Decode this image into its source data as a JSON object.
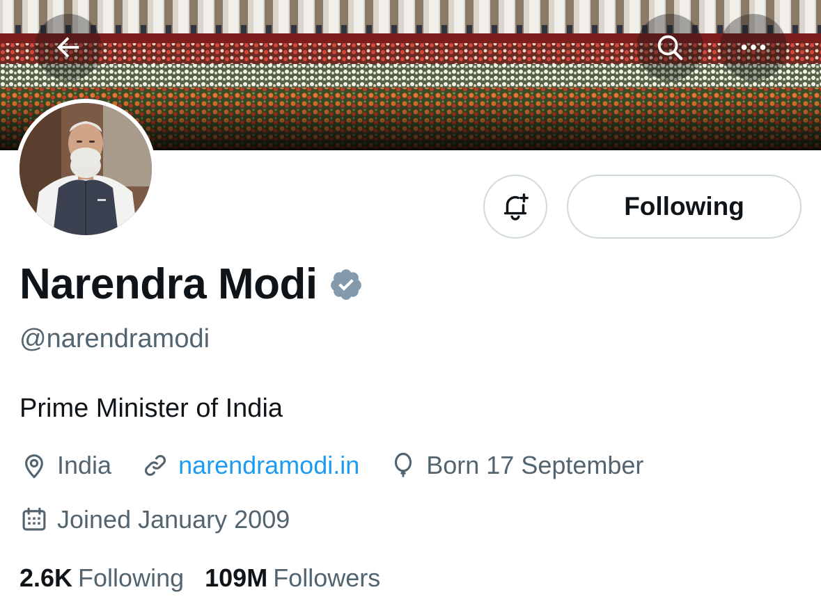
{
  "header": {
    "back_icon": "arrow-left-icon",
    "search_icon": "search-icon",
    "more_icon": "more-horizontal-icon"
  },
  "profile": {
    "name": "Narendra Modi",
    "handle": "@narendramodi",
    "bio": "Prime Minister of India",
    "verified_color": "#829aab"
  },
  "actions": {
    "notify_icon": "bell-plus-icon",
    "follow_label": "Following"
  },
  "meta": {
    "location": "India",
    "website": "narendramodi.in",
    "birthday": "Born 17 September",
    "joined": "Joined January 2009"
  },
  "stats": {
    "following_count": "2.6K",
    "following_label": "Following",
    "followers_count": "109M",
    "followers_label": "Followers"
  },
  "colors": {
    "accent": "#1d9bf0",
    "text_primary": "#0f1419",
    "text_secondary": "#536471",
    "border": "#cfd9de"
  }
}
